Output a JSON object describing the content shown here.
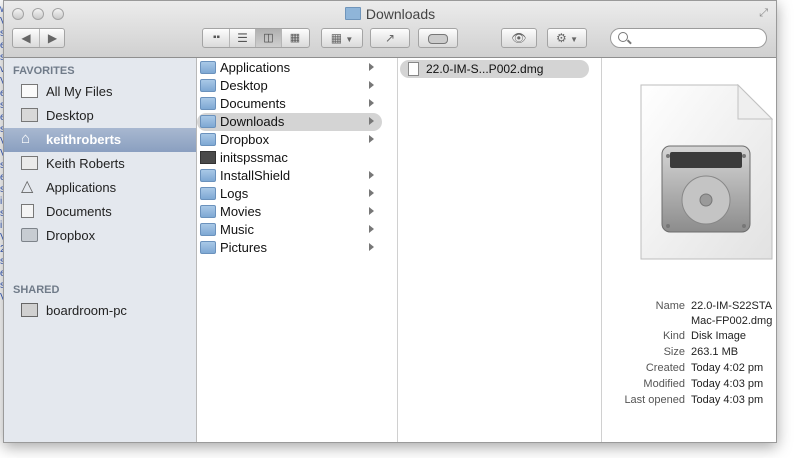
{
  "window": {
    "title": "Downloads"
  },
  "sidebar": {
    "favorites_header": "FAVORITES",
    "items": [
      {
        "label": "All My Files",
        "icon": "all-files-icon"
      },
      {
        "label": "Desktop",
        "icon": "desktop-icon"
      },
      {
        "label": "keithroberts",
        "icon": "home-icon",
        "selected": true
      },
      {
        "label": "Keith Roberts",
        "icon": "user-icon"
      },
      {
        "label": "Applications",
        "icon": "applications-icon"
      },
      {
        "label": "Documents",
        "icon": "documents-icon"
      },
      {
        "label": "Dropbox",
        "icon": "folder-icon"
      }
    ],
    "shared_header": "SHARED",
    "shared_items": [
      {
        "label": "boardroom-pc",
        "icon": "pc-icon"
      }
    ]
  },
  "column1": {
    "items": [
      {
        "label": "Applications",
        "arrow": true
      },
      {
        "label": "Desktop",
        "arrow": true
      },
      {
        "label": "Documents",
        "arrow": true
      },
      {
        "label": "Downloads",
        "arrow": true,
        "selected": true
      },
      {
        "label": "Dropbox",
        "arrow": true
      },
      {
        "label": "initspssmac",
        "arrow": false
      },
      {
        "label": "InstallShield",
        "arrow": true
      },
      {
        "label": "Logs",
        "arrow": true
      },
      {
        "label": "Movies",
        "arrow": true
      },
      {
        "label": "Music",
        "arrow": true
      },
      {
        "label": "Pictures",
        "arrow": true
      }
    ]
  },
  "column2": {
    "items": [
      {
        "label": "22.0-IM-S...P002.dmg",
        "selected": true
      }
    ]
  },
  "preview": {
    "name_label": "Name",
    "name_line1": "22.0-IM-S22STA",
    "name_line2": "Mac-FP002.dmg",
    "kind_label": "Kind",
    "kind": "Disk Image",
    "size_label": "Size",
    "size": "263.1 MB",
    "created_label": "Created",
    "created": "Today 4:02 pm",
    "modified_label": "Modified",
    "modified": "Today 4:03 pm",
    "opened_label": "Last opened",
    "opened": "Today 4:03 pm"
  }
}
